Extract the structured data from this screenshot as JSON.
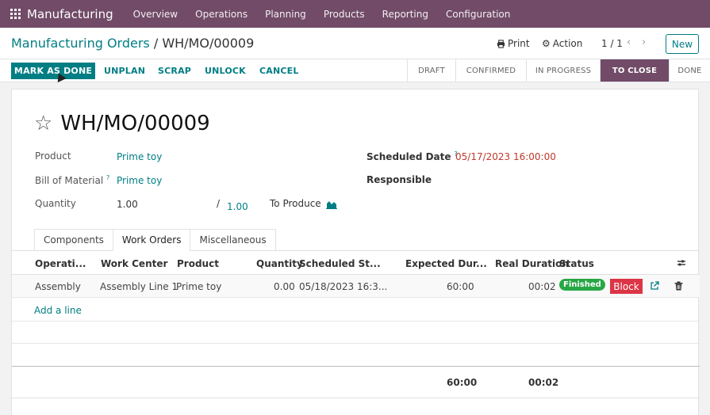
{
  "navbar": {
    "app_name": "Manufacturing",
    "items": [
      "Overview",
      "Operations",
      "Planning",
      "Products",
      "Reporting",
      "Configuration"
    ]
  },
  "control": {
    "breadcrumb_parent": "Manufacturing Orders",
    "breadcrumb_sep": " / ",
    "breadcrumb_current": "WH/MO/00009",
    "print_label": "Print",
    "action_label": "Action",
    "pager": "1 / 1",
    "new_label": "New"
  },
  "actions": {
    "mark_as_done": "MARK AS DONE",
    "unplan": "UNPLAN",
    "scrap": "SCRAP",
    "unlock": "UNLOCK",
    "cancel": "CANCEL"
  },
  "stages": [
    {
      "label": "DRAFT",
      "active": false
    },
    {
      "label": "CONFIRMED",
      "active": false
    },
    {
      "label": "IN PROGRESS",
      "active": false
    },
    {
      "label": "TO CLOSE",
      "active": true
    },
    {
      "label": "DONE",
      "active": false
    }
  ],
  "form": {
    "name": "WH/MO/00009",
    "product_label": "Product",
    "product_value": "Prime toy",
    "bom_label": "Bill of Material",
    "bom_help": "?",
    "bom_value": "Prime toy",
    "quantity_label": "Quantity",
    "quantity_value": "1.00",
    "quantity_sep": "/",
    "quantity_produced": "1.00",
    "uom_value": "To Produce",
    "scheduled_label": "Scheduled Date",
    "scheduled_help": "?",
    "scheduled_value": "05/17/2023 16:00:00",
    "responsible_label": "Responsible"
  },
  "tabs": [
    "Components",
    "Work Orders",
    "Miscellaneous"
  ],
  "table": {
    "headers": [
      "Operati...",
      "Work Center",
      "Product",
      "Quantity",
      "Scheduled St...",
      "Expected Dur...",
      "Real Duration",
      "Status"
    ],
    "row": {
      "operation": "Assembly",
      "work_center": "Assembly Line 1",
      "product": "Prime toy",
      "quantity": "0.00",
      "scheduled": "05/18/2023 16:3...",
      "expected": "60:00",
      "real": "00:02",
      "status": "Finished",
      "block": "Block"
    },
    "add_line": "Add a line",
    "total_expected": "60:00",
    "total_real": "00:02"
  },
  "colors": {
    "brand": "#714b67",
    "primary": "#017e84",
    "danger": "#dc3545",
    "success": "#28a745"
  }
}
